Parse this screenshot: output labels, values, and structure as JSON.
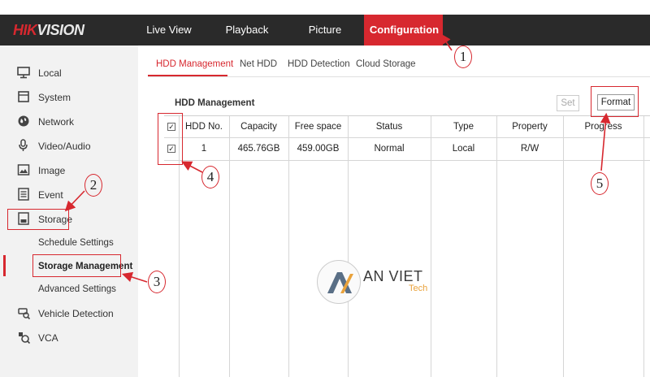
{
  "brand": {
    "logo_text_red": "HIK",
    "logo_text_white": "VISION"
  },
  "nav": {
    "tabs": [
      {
        "label": "Live View"
      },
      {
        "label": "Playback"
      },
      {
        "label": "Picture"
      },
      {
        "label": "Configuration",
        "active": true
      }
    ]
  },
  "sidebar": {
    "items": [
      {
        "label": "Local",
        "icon": "monitor-icon"
      },
      {
        "label": "System",
        "icon": "system-icon"
      },
      {
        "label": "Network",
        "icon": "globe-icon"
      },
      {
        "label": "Video/Audio",
        "icon": "mic-icon"
      },
      {
        "label": "Image",
        "icon": "image-icon"
      },
      {
        "label": "Event",
        "icon": "list-icon"
      },
      {
        "label": "Storage",
        "icon": "storage-icon"
      }
    ],
    "storage_sub": [
      {
        "label": "Schedule Settings"
      },
      {
        "label": "Storage Management",
        "active": true
      },
      {
        "label": "Advanced Settings"
      }
    ],
    "extra_items": [
      {
        "label": "Vehicle Detection",
        "icon": "vehicle-search-icon"
      },
      {
        "label": "VCA",
        "icon": "vca-icon"
      }
    ]
  },
  "subtabs": [
    {
      "label": "HDD Management",
      "active": true
    },
    {
      "label": "Net HDD"
    },
    {
      "label": "HDD Detection"
    },
    {
      "label": "Cloud Storage"
    }
  ],
  "panel": {
    "title": "HDD Management",
    "set_label": "Set",
    "format_label": "Format"
  },
  "table": {
    "headers": [
      "HDD No.",
      "Capacity",
      "Free space",
      "Status",
      "Type",
      "Property",
      "Progress"
    ],
    "rows": [
      {
        "checked": true,
        "cells": [
          "1",
          "465.76GB",
          "459.00GB",
          "Normal",
          "Local",
          "R/W",
          ""
        ]
      }
    ],
    "header_checked": true
  },
  "annotations": [
    "1",
    "2",
    "3",
    "4",
    "5"
  ],
  "watermark": {
    "main": "AN VIET",
    "sub": "Tech"
  },
  "colors": {
    "accent": "#d7282f",
    "topbar": "#2a2a2a",
    "sidebar": "#f2f2f2"
  }
}
